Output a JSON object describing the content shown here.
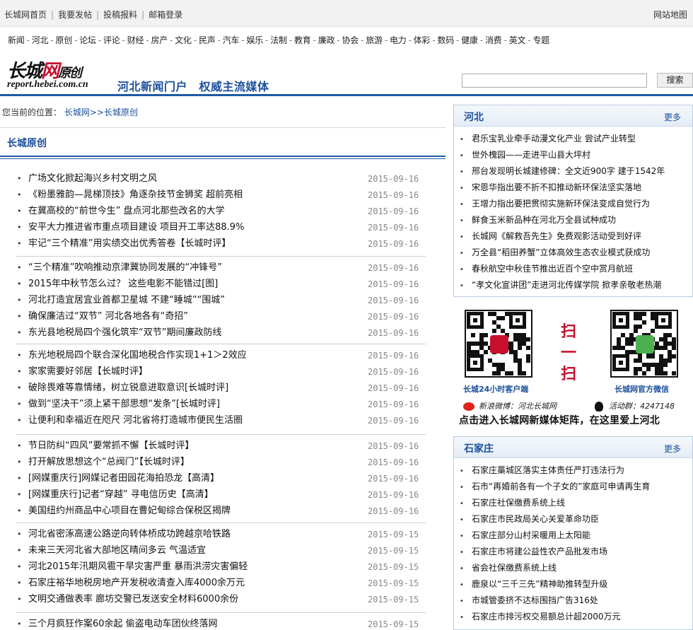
{
  "topbar": {
    "links": [
      "长城网首页",
      "我要发帖",
      "投稿报料",
      "邮箱登录"
    ],
    "sitemap": "网站地图"
  },
  "nav": [
    "新闻",
    "河北",
    "原创",
    "论坛",
    "评论",
    "财经",
    "房产",
    "文化",
    "民声",
    "汽车",
    "娱乐",
    "法制",
    "教育",
    "廉政",
    "协会",
    "旅游",
    "电力",
    "体彩",
    "数码",
    "健康",
    "消费",
    "英文",
    "专题"
  ],
  "logo": {
    "name_black": "长城",
    "name_red": "网",
    "name_suffix": "原创",
    "url": "report.hebei.com.cn"
  },
  "slogan": "河北新闻门户　权威主流媒体",
  "search": {
    "button": "搜索",
    "value": ""
  },
  "breadcrumb": {
    "label": "您当前的位置：",
    "path": "长城网>>长城原创"
  },
  "section_title": "长城原创",
  "news_groups": [
    [
      {
        "title": "广场文化掀起海兴乡村文明之风",
        "date": "2015-09-16"
      },
      {
        "title": "《粉墨雅韵—晁梯顶技》角逐杂技节金狮奖 超前亮相",
        "date": "2015-09-16"
      },
      {
        "title": "在冀高校的“前世今生” 盘点河北那些改名的大学",
        "date": "2015-09-16"
      },
      {
        "title": "安平大力推进省市重点项目建设 项目开工率达88.9%",
        "date": "2015-09-16"
      },
      {
        "title": "牢记“三个精准”用实绩交出优秀答卷【长城时评】",
        "date": "2015-09-16"
      }
    ],
    [
      {
        "title": "“三个精准”吹响推动京津冀协同发展的“冲锋号”",
        "date": "2015-09-16"
      },
      {
        "title": "2015年中秋节怎么过？ 这些电影不能错过[图]",
        "date": "2015-09-16"
      },
      {
        "title": "河北打造宜居宜业首都卫星城 不建“睡城”“围城”",
        "date": "2015-09-16"
      },
      {
        "title": "确保廉洁过“双节” 河北各地各有“奇招”",
        "date": "2015-09-16"
      },
      {
        "title": "东光县地税局四个强化筑牢“双节”期间廉政防线",
        "date": "2015-09-16"
      }
    ],
    [
      {
        "title": "东光地税局四个联合深化国地税合作实现1+1＞2效应",
        "date": "2015-09-16"
      },
      {
        "title": "家家需要好邻居【长城时评】",
        "date": "2015-09-16"
      },
      {
        "title": "破除畏难等靠情绪，树立锐意进取意识[长城时评]",
        "date": "2015-09-16"
      },
      {
        "title": "做到“坚决干”须上紧干部思想“发条”[长城时评]",
        "date": "2015-09-16"
      },
      {
        "title": "让便利和幸福近在咫尺 河北省将打造城市便民生活圈",
        "date": "2015-09-16"
      }
    ],
    [
      {
        "title": "节日防纠“四风”要常抓不懈【长城时评】",
        "date": "2015-09-16"
      },
      {
        "title": "打开解放思想这个“总阀门”【长城时评】",
        "date": "2015-09-16"
      },
      {
        "title": "[网媒重庆行]网媒记者田园花海拍恐龙【高清】",
        "date": "2015-09-16"
      },
      {
        "title": "[网媒重庆行]记者“穿越” 寻电信历史【高清】",
        "date": "2015-09-16"
      },
      {
        "title": "美国纽约州商品中心项目在曹妃甸综合保税区揭牌",
        "date": "2015-09-16"
      }
    ],
    [
      {
        "title": "河北省密涿高速公路逆向转体桥成功跨越京哈铁路",
        "date": "2015-09-15"
      },
      {
        "title": "未来三天河北省大部地区晴间多云 气温适宜",
        "date": "2015-09-15"
      },
      {
        "title": "河北2015年汛期风雹干旱灾害严重 暴雨洪涝灾害偏轻",
        "date": "2015-09-15"
      },
      {
        "title": "石家庄裕华地税房地产开发税收清查入库4000余万元",
        "date": "2015-09-15"
      },
      {
        "title": "文明交通做表率 廊坊交警已发送安全材料6000余份",
        "date": "2015-09-15"
      }
    ],
    [
      {
        "title": "三个月疯狂作案60余起 偷盗电动车团伙终落网",
        "date": "2015-09-15"
      }
    ]
  ],
  "hebei_box": {
    "title": "河北",
    "more": "更多",
    "items": [
      "君乐宝乳业牵手动漫文化产业 尝试产业转型",
      "世外槐园——走进平山县大坪村",
      "邢台发现明长城建修碑：全文近900字 建于1542年",
      "宋恩华指出要不折不扣推动新环保法坚实落地",
      "王增力指出要把贯彻实施新环保法变成自觉行为",
      "鲜食玉米新品种在河北万全县试种成功",
      "长城网《解救吾先生》免费观影活动受到好评",
      "万全县“稻田养蟹”立体高效生态农业模式获成功",
      "春秋航空中秋佳节推出近百个空中赏月航班",
      "“孝文化宣讲团”走进河北传媒学院 掀孝亲敬老热潮"
    ]
  },
  "promo": {
    "scan": "扫一扫",
    "client_caption": "长城24小时客户端",
    "wechat_caption": "长城网官方微信",
    "weibo": "新浪微博：河北长城网",
    "qq_group": "活动群：4247148",
    "tagline": "点击进入长城网新媒体矩阵，在这里爱上河北",
    "colors": {
      "red": "#c8102e",
      "wechat_green": "#4caf50"
    }
  },
  "sjz_box": {
    "title": "石家庄",
    "more": "更多",
    "items": [
      "石家庄藁城区落实主体责任严打违法行为",
      "石市“再婚前各有一个子女的”家庭可申请再生育",
      "石家庄社保缴费系统上线",
      "石家庄市民政局关心关爱革命功臣",
      "石家庄部分山村采暖用上太阳能",
      "石家庄市将建公益性农产品批发市场",
      "省会社保缴费系统上线",
      "鹿泉以“三千三先”精神助推转型升级",
      "市城管委挤不达标围挡广告316处",
      "石家庄市排污权交易额总计超2000万元"
    ]
  }
}
